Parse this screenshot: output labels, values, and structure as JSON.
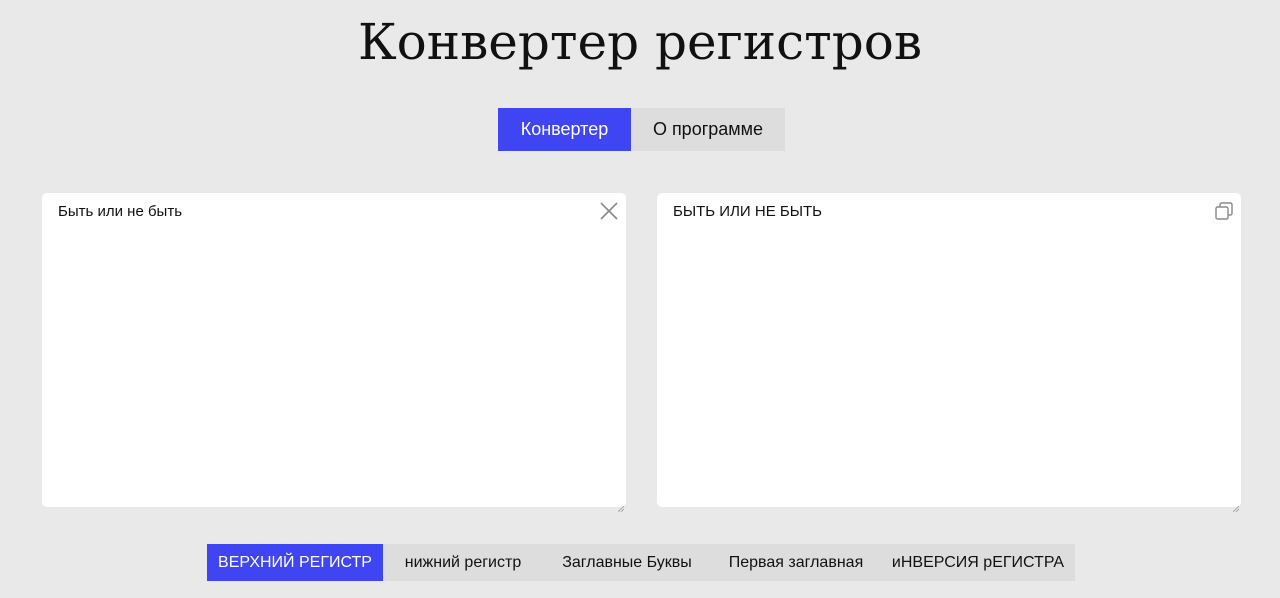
{
  "header": {
    "title": "Конвертер регистров"
  },
  "tabs": [
    {
      "label": "Конвертер",
      "active": true
    },
    {
      "label": "О программе",
      "active": false
    }
  ],
  "input_panel": {
    "value": "Быть или не быть",
    "clear_icon": "close-icon"
  },
  "output_panel": {
    "value": "БЫТЬ ИЛИ НЕ БЫТЬ",
    "copy_icon": "copy-icon"
  },
  "modes": [
    {
      "label": "ВЕРХНИЙ РЕГИСТР",
      "active": true
    },
    {
      "label": "нижний регистр",
      "active": false
    },
    {
      "label": "Заглавные Буквы",
      "active": false
    },
    {
      "label": "Первая заглавная",
      "active": false
    },
    {
      "label": "иНВЕРСИЯ рЕГИСТРА",
      "active": false
    }
  ],
  "colors": {
    "accent": "#3f45f2",
    "background": "#e9e9e9",
    "inactive": "#dddddd",
    "panel": "#ffffff"
  }
}
